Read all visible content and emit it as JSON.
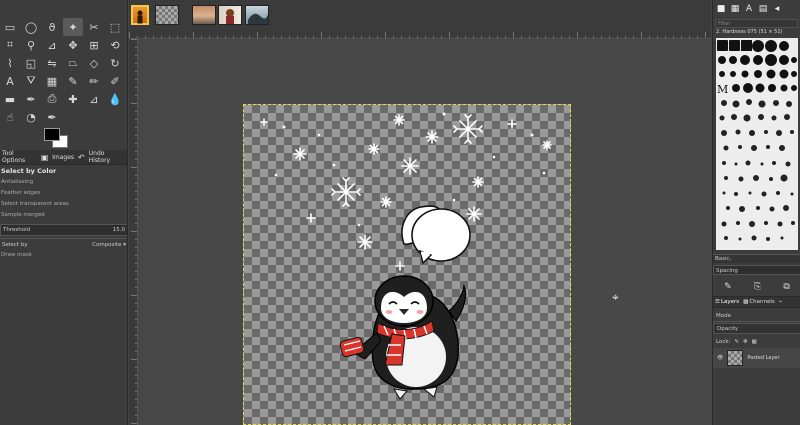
{
  "toolbox": {
    "tools": [
      "rect-select-icon",
      "ellipse-select-icon",
      "lasso-icon",
      "fuzzy-select-icon",
      "scissors-icon",
      "foreground-select-icon",
      "crop-icon",
      "zoom-icon",
      "measure-icon",
      "move-icon",
      "align-icon",
      "transform-icon",
      "warp-icon",
      "unified-transform-icon",
      "flip-icon",
      "perspective-icon",
      "cage-icon",
      "rotate-icon",
      "text-icon",
      "bucket-fill-icon",
      "gradient-icon",
      "paintbrush-icon",
      "pencil-icon",
      "airbrush-icon",
      "eraser-icon",
      "ink-icon",
      "clone-icon",
      "heal-icon",
      "perspective-clone-icon",
      "blur-icon",
      "smudge-icon",
      "dodge-icon",
      "path-icon"
    ],
    "tabs": {
      "tool_options": "Tool Options",
      "images": "Images",
      "undo_history": "Undo History"
    },
    "options": {
      "title": "Select by Color",
      "antialiasing": "Antialiasing",
      "feather_edges": "Feather edges",
      "select_transparent": "Select transparent areas",
      "sample_merged": "Sample merged",
      "threshold_label": "Threshold",
      "threshold_value": "15.0",
      "select_by_label": "Select by",
      "select_by_value": "Composite",
      "draw_mask": "Draw mask"
    }
  },
  "image_tabs": [
    "portrait-thumbnail",
    "penguin-thumbnail",
    "sunset-thumbnail",
    "woman-thumbnail",
    "wave-thumbnail"
  ],
  "brushes": {
    "filter_placeholder": "Filter",
    "selected": "2. Hardness 075 (51 × 51)",
    "mode": "Basic,",
    "spacing": "Spacing"
  },
  "layers": {
    "tabs": {
      "layers": "Layers",
      "channels": "Channels"
    },
    "mode_label": "Mode",
    "opacity_label": "Opacity",
    "lock_label": "Lock:",
    "layer_name": "Pasted Layer"
  },
  "colors": {
    "accent_active_tab": "#f2c94c",
    "scarf_red": "#d8352c"
  }
}
